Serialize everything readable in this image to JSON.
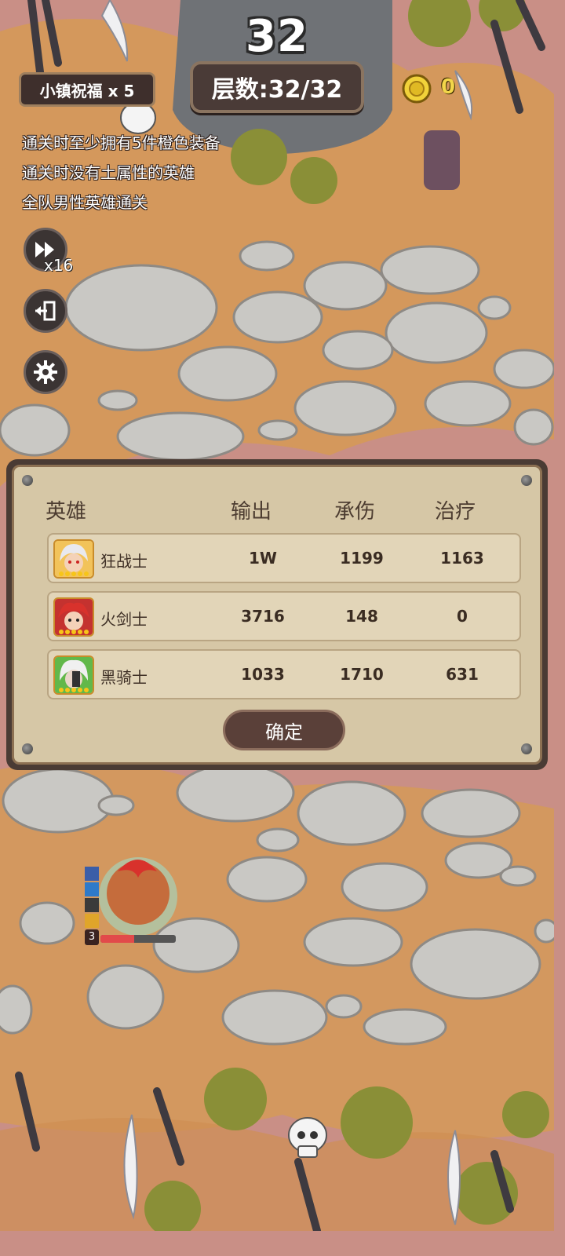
{
  "hud": {
    "floor_number": "32",
    "floor_label": "层数:32/32",
    "blessing_label": "小镇祝福 x 5",
    "coin_count": "0",
    "speed_label": "x16"
  },
  "quests": [
    "通关时至少拥有5件橙色装备",
    "通关时没有土属性的英雄",
    "全队男性英雄通关"
  ],
  "side_buttons": [
    {
      "icon": "fast-forward-icon"
    },
    {
      "icon": "exit-icon"
    },
    {
      "icon": "gear-icon"
    }
  ],
  "result_panel": {
    "headers": {
      "hero": "英雄",
      "damage": "输出",
      "taken": "承伤",
      "heal": "治疗"
    },
    "rows": [
      {
        "name": "狂战士",
        "damage": "1W",
        "taken": "1199",
        "heal": "1163",
        "avatar_hair": "#e9e9ef",
        "avatar_bg": "#f2c35a"
      },
      {
        "name": "火剑士",
        "damage": "3716",
        "taken": "148",
        "heal": "0",
        "avatar_hair": "#d8322c",
        "avatar_bg": "#c4322f"
      },
      {
        "name": "黑骑士",
        "damage": "1033",
        "taken": "1710",
        "heal": "631",
        "avatar_hair": "#f0f0f0",
        "avatar_bg": "#62b84a"
      }
    ],
    "confirm_label": "确定"
  },
  "field_hero": {
    "level": "3",
    "hp_fraction": 0.45
  },
  "colors": {
    "ground": "#c98f86",
    "sand": "#d9a04e",
    "stone": "#c9c8c4",
    "panel_dark": "#4a3b34",
    "panel_light": "#d6c7a6"
  }
}
